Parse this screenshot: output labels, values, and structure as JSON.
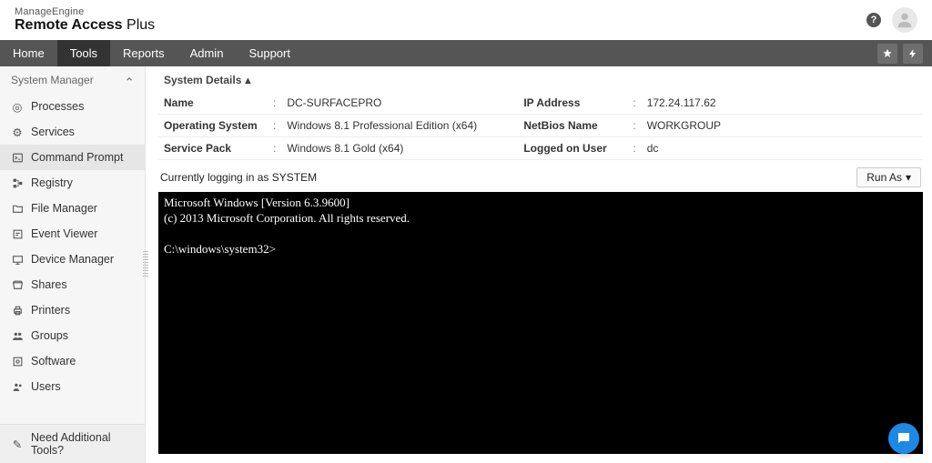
{
  "brand": {
    "top": "ManageEngine",
    "bottom_bold": "Remote Access",
    "bottom_light": " Plus"
  },
  "nav": {
    "items": [
      {
        "label": "Home"
      },
      {
        "label": "Tools"
      },
      {
        "label": "Reports"
      },
      {
        "label": "Admin"
      },
      {
        "label": "Support"
      }
    ]
  },
  "sidebar": {
    "header": "System Manager",
    "items": [
      {
        "label": "Processes"
      },
      {
        "label": "Services"
      },
      {
        "label": "Command Prompt"
      },
      {
        "label": "Registry"
      },
      {
        "label": "File Manager"
      },
      {
        "label": "Event Viewer"
      },
      {
        "label": "Device Manager"
      },
      {
        "label": "Shares"
      },
      {
        "label": "Printers"
      },
      {
        "label": "Groups"
      },
      {
        "label": "Software"
      },
      {
        "label": "Users"
      }
    ],
    "footer": {
      "label": "Need Additional Tools?"
    }
  },
  "details": {
    "title": "System Details",
    "rows": [
      {
        "l1": "Name",
        "v1": "DC-SURFACEPRO",
        "l2": "IP Address",
        "v2": "172.24.117.62"
      },
      {
        "l1": "Operating System",
        "v1": "Windows 8.1 Professional Edition (x64)",
        "l2": "NetBios Name",
        "v2": "WORKGROUP"
      },
      {
        "l1": "Service Pack",
        "v1": "Windows 8.1 Gold (x64)",
        "l2": "Logged on User",
        "v2": "dc"
      }
    ]
  },
  "status": {
    "text": "Currently logging in as SYSTEM",
    "runas_label": "Run As"
  },
  "terminal": {
    "line1": "Microsoft Windows [Version 6.3.9600]",
    "line2": "(c) 2013 Microsoft Corporation. All rights reserved.",
    "prompt": "C:\\windows\\system32>"
  }
}
